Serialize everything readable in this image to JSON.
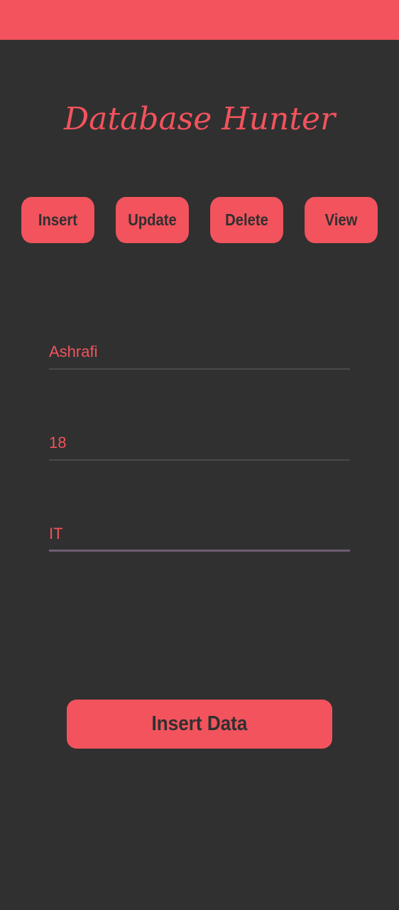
{
  "app": {
    "title": "Database Hunter",
    "accent_color": "#f2535d",
    "background_color": "#303030"
  },
  "tabs": [
    {
      "label": "Insert"
    },
    {
      "label": "Update"
    },
    {
      "label": "Delete"
    },
    {
      "label": "View"
    }
  ],
  "form": {
    "name_value": "Ashrafi",
    "age_value": "18",
    "department_value": "IT"
  },
  "actions": {
    "insert_data_label": "Insert Data"
  }
}
